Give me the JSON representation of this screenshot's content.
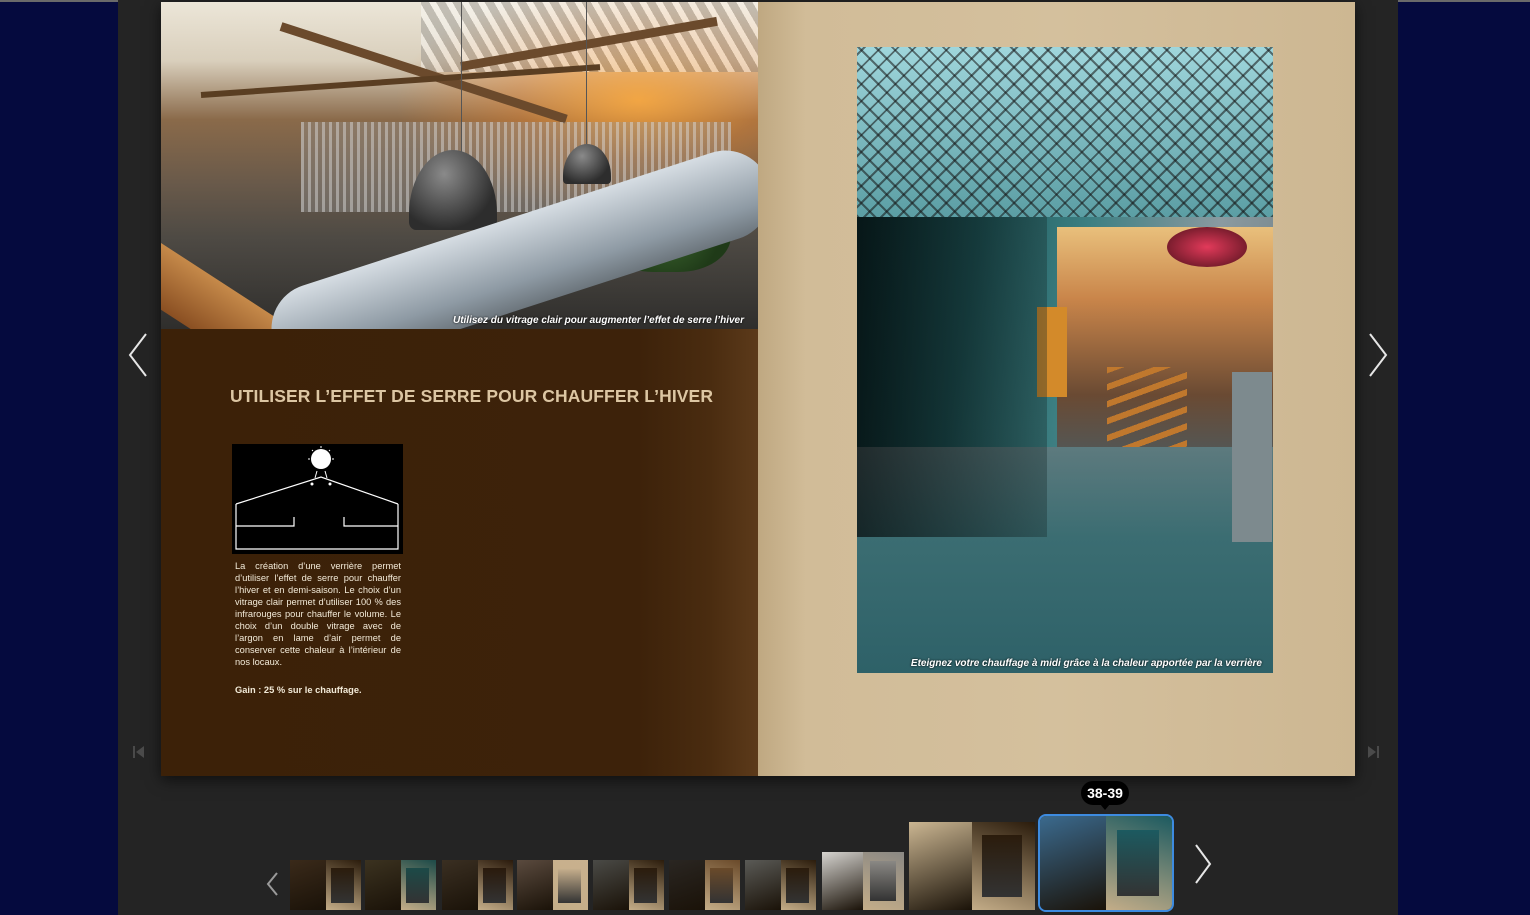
{
  "viewer": {
    "background_color": "#050a3e",
    "stage_color": "#242424"
  },
  "left_page": {
    "photo_caption": "Utilisez du vitrage clair pour augmenter l’effet de serre l’hiver",
    "heading": "UTILISER L’EFFET DE SERRE POUR CHAUFFER L’HIVER",
    "body": "La création d’une verrière permet d’utiliser l’effet de serre pour chauffer l’hiver et en demi-saison. Le choix d’un vitrage clair permet d’utiliser 100 % des infrarouges pour chauffer le volume. Le choix d’un double vitrage avec de l’argon en lame d’air permet de conserver cette chaleur à l’intérieur de nos locaux.",
    "gain": "Gain : 25 % sur le chauffage.",
    "page_color": "#3d220a",
    "heading_color": "#dcc6a3"
  },
  "right_page": {
    "photo_caption": "Eteignez votre chauffage à midi grâce à la chaleur apportée par la verrière",
    "page_color": "#d4c09d"
  },
  "navigation": {
    "prev_icon": "chevron-left-icon",
    "next_icon": "chevron-right-icon",
    "first_page_icon": "skip-first-icon",
    "last_page_icon": "skip-last-icon"
  },
  "thumbnails": {
    "tooltip": "38-39",
    "prev_icon": "chevron-left-icon",
    "next_icon": "chevron-right-icon",
    "accent_color": "#3d8be0",
    "items": [
      {
        "left": "#3a2a1a",
        "right": "#2b1c0c"
      },
      {
        "left": "#3b3220",
        "right": "#1c4a48"
      },
      {
        "left": "#3a2f22",
        "right": "#2a1a0c"
      },
      {
        "left": "#5a4a3e",
        "right": "#c9b18e"
      },
      {
        "left": "#4a4a46",
        "right": "#2b1c0c"
      },
      {
        "left": "#2a2622",
        "right": "#6a4a2a"
      },
      {
        "left": "#5a5a56",
        "right": "#2b1c0c"
      },
      {
        "left": "#d6d4d0",
        "right": "#8a8884"
      },
      {
        "left": "#cbb692",
        "right": "#2b1c0c"
      },
      {
        "left": "#3b6a8e",
        "right": "#1c5a60"
      }
    ]
  }
}
